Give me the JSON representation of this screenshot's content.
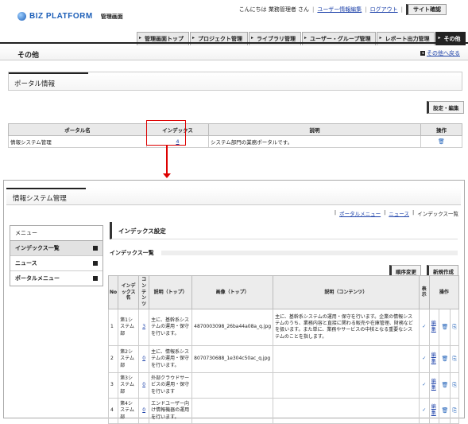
{
  "header": {
    "brand": "BIZ PLATFORM",
    "subtitle": "管理画面",
    "greeting": "こんにちは 業務管理者 さん",
    "user_link": "ユーザー情報編集",
    "logout": "ログアウト",
    "site_button": "サイト確認"
  },
  "tabs": [
    "管理画面トップ",
    "プロジェクト管理",
    "ライブラリ管理",
    "ユーザー・グループ管理",
    "レポート出力管理",
    "その他"
  ],
  "page": {
    "title": "その他",
    "back_link": "その他へ戻る"
  },
  "portal": {
    "title": "ポータル情報",
    "edit_button": "設定・編集",
    "columns": [
      "ポータル名",
      "インデックス",
      "説明",
      "操作"
    ],
    "row": {
      "name": "情報システム管理",
      "index": "4",
      "description": "システム部門の業務ポータルです。"
    }
  },
  "inner": {
    "title": "情報システム管理",
    "breadcrumbs": {
      "portal_menu": "ポータルメニュー",
      "news": "ニュース",
      "current": "インデックス一覧"
    },
    "sidebar": {
      "head": "メニュー",
      "items": [
        "インデックス一覧",
        "ニュース",
        "ポータルメニュー"
      ]
    },
    "section_title": "インデックス設定",
    "list_title": "インデックス一覧",
    "sort_button": "順序変更",
    "new_button": "新規作成",
    "columns": {
      "no": "No",
      "name": "インデックス名",
      "contents": "コンテンツ",
      "desc_top": "説明（トップ）",
      "image_top": "画像（トップ）",
      "desc_contents": "説明（コンテンツ）",
      "display": "表示",
      "ops": "操作"
    },
    "rows": [
      {
        "no": "1",
        "name": "第1システム部",
        "contents": "3",
        "desc_top": "主に、基幹系システムの運用・保守を行います。",
        "image": "4870003098_26ba44a08a_q.jpg",
        "desc_contents": "主に、基幹系システムの運用・保守を行います。企業の情報システムのうち、業務内容と直接に関わる販売や在庫管理、財務などを扱います。また単に、業務やサービスの中核となる重要なシステムのことを指します。",
        "edit": "編集"
      },
      {
        "no": "2",
        "name": "第2システム部",
        "contents": "0",
        "desc_top": "主に、情報系システムの運用・保守を行います。",
        "image": "8070730688_1e304c50ac_q.jpg",
        "desc_contents": "",
        "edit": "編集"
      },
      {
        "no": "3",
        "name": "第3システム部",
        "contents": "0",
        "desc_top": "外部クラウドサービスの運用・保守を行います",
        "image": "",
        "desc_contents": "",
        "edit": "編集"
      },
      {
        "no": "4",
        "name": "第4システム部",
        "contents": "0",
        "desc_top": "エンドユーザー向け情報機器の運用を行います。",
        "image": "",
        "desc_contents": "",
        "edit": "編集"
      }
    ]
  },
  "colors": {
    "accent": "#1d5fb8",
    "highlight": "#dd0000",
    "dark": "#222222"
  }
}
